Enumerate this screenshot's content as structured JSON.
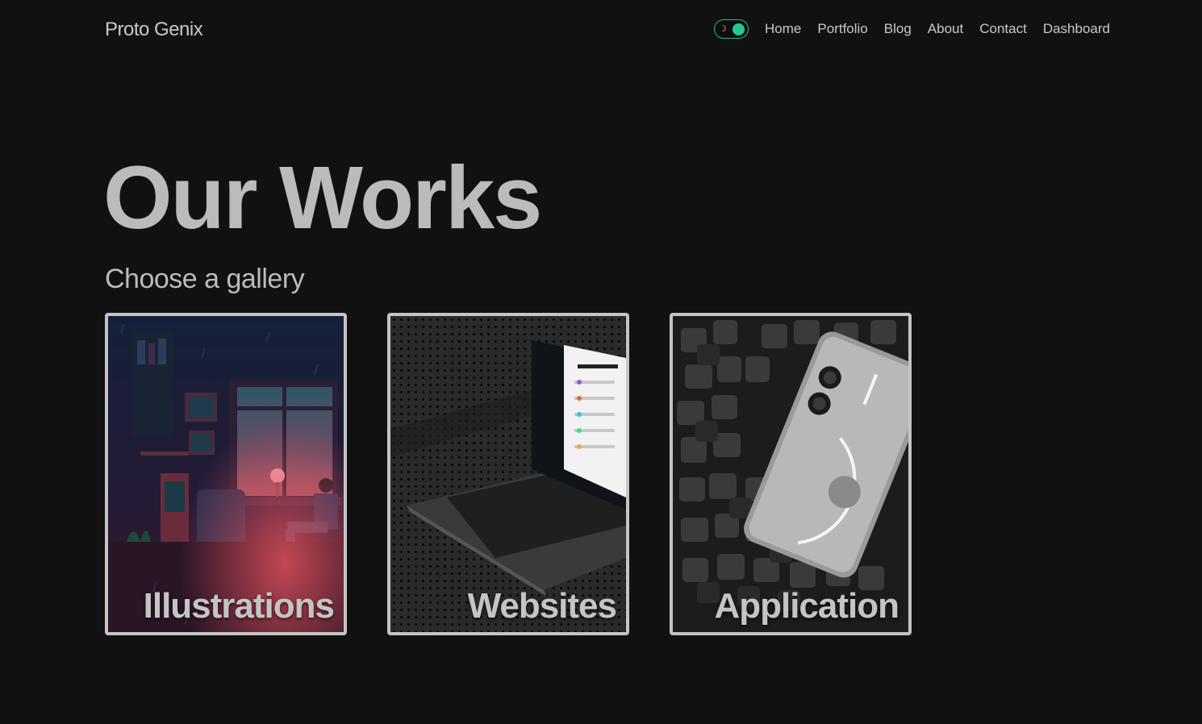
{
  "brand": "Proto Genix",
  "nav": {
    "links": [
      {
        "label": "Home"
      },
      {
        "label": "Portfolio"
      },
      {
        "label": "Blog"
      },
      {
        "label": "About"
      },
      {
        "label": "Contact"
      },
      {
        "label": "Dashboard"
      }
    ],
    "theme_toggle": {
      "icon": "moon-icon",
      "state": "dark"
    }
  },
  "hero": {
    "title": "Our Works",
    "subtitle": "Choose a gallery"
  },
  "galleries": [
    {
      "label": "Illustrations",
      "image": "pixel-art-room-illustration"
    },
    {
      "label": "Websites",
      "image": "laptop-website-mockup"
    },
    {
      "label": "Application",
      "image": "phone-on-foam-cubes"
    }
  ],
  "colors": {
    "background": "#111111",
    "text": "#c8c8c8",
    "accent": "#20c997",
    "card_border": "#c4c4c4"
  }
}
